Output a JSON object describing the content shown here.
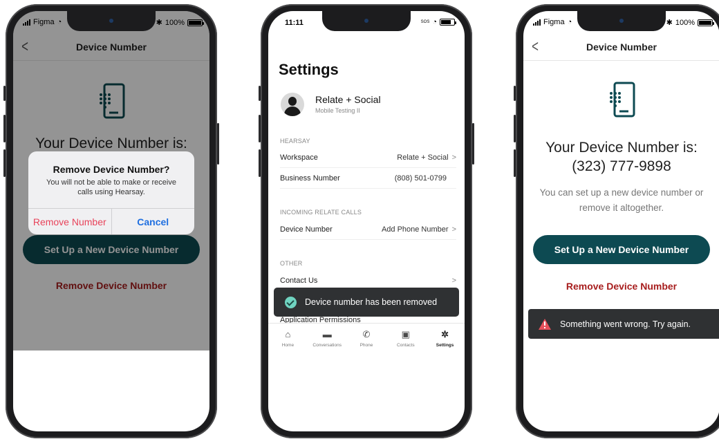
{
  "colors": {
    "accent": "#0d4a52",
    "danger": "#a71d1d",
    "ios_blue": "#1f6fe0",
    "ios_red": "#e8435a",
    "toast_bg": "#2f3133",
    "success": "#6fd3c0",
    "error": "#e8505b"
  },
  "phone1": {
    "status": {
      "carrier": "Figma",
      "battery": "100%"
    },
    "nav_title": "Device Number",
    "heading": "Your Device Number is:",
    "cta_label": "Set Up a New Device Number",
    "remove_label": "Remove Device Number",
    "alert": {
      "title": "Remove Device Number?",
      "message": "You will not be able to make or receive calls using Hearsay.",
      "remove_button": "Remove Number",
      "cancel_button": "Cancel"
    }
  },
  "phone2": {
    "status": {
      "time": "11:11",
      "sos": "SOS"
    },
    "title": "Settings",
    "profile": {
      "name": "Relate + Social",
      "subtitle": "Mobile Testing II"
    },
    "sections": {
      "hearsay": "HEARSAY",
      "incoming": "INCOMING RELATE CALLS",
      "other": "OTHER"
    },
    "rows": {
      "workspace": {
        "label": "Workspace",
        "value": "Relate + Social"
      },
      "business": {
        "label": "Business Number",
        "value": "(808) 501-0799"
      },
      "device": {
        "label": "Device Number",
        "value": "Add Phone Number"
      },
      "contact": {
        "label": "Contact Us"
      },
      "application": {
        "label": "Application Permissions"
      }
    },
    "toast": "Device number has been removed",
    "tabs": [
      "Home",
      "Conversations",
      "Phone",
      "Contacts",
      "Settings"
    ],
    "active_tab": "Settings"
  },
  "phone3": {
    "status": {
      "carrier": "Figma",
      "battery": "100%"
    },
    "nav_title": "Device Number",
    "heading_line1": "Your Device Number is:",
    "heading_line2": "(323) 777-9898",
    "subtext": "You can set up a new device number or remove it altogether.",
    "cta_label": "Set Up a New Device Number",
    "remove_label": "Remove Device Number",
    "toast": "Something went wrong. Try again."
  }
}
